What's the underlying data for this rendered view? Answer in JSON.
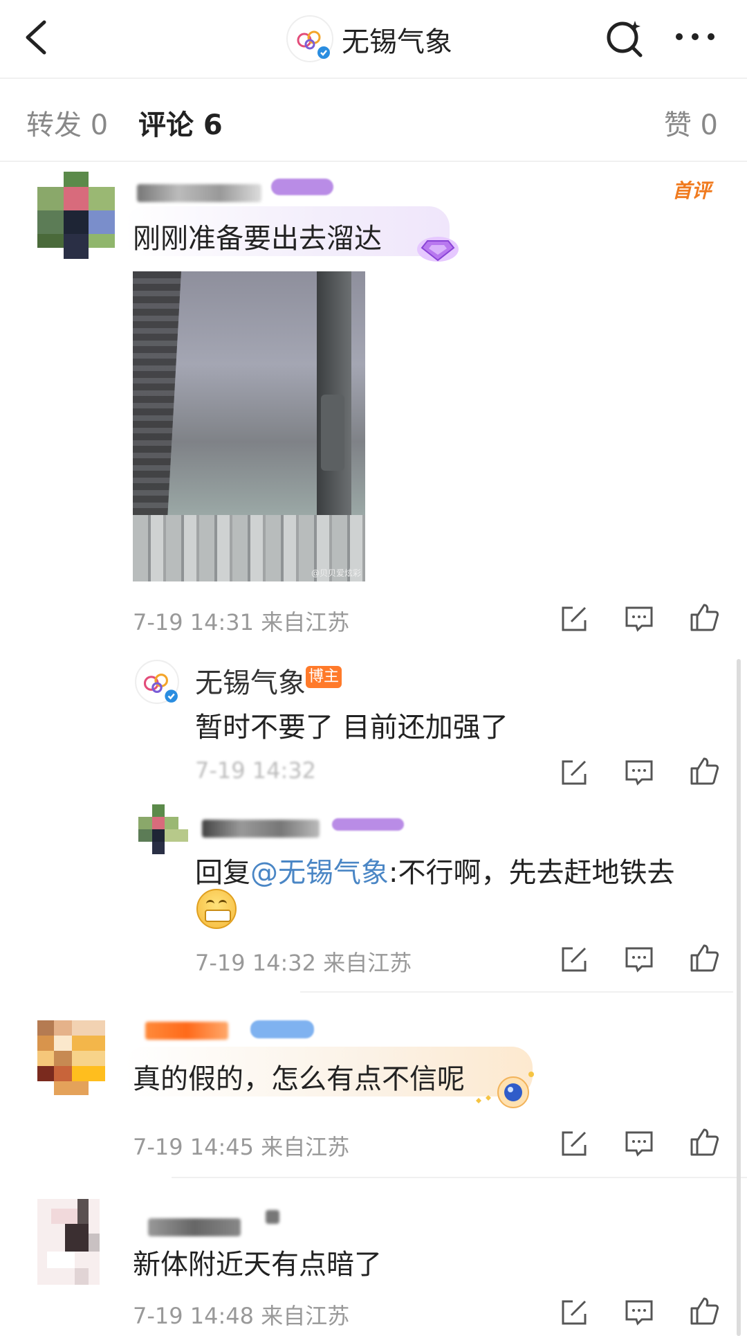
{
  "header": {
    "title": "无锡气象",
    "back_icon": "chevron-left-icon",
    "search_icon": "search-sparkle-icon",
    "more_icon": "more-horizontal-icon"
  },
  "tabs": {
    "repost": "转发 0",
    "comments": "评论 6",
    "likes": "赞 0"
  },
  "comments": [
    {
      "first_label": "首评",
      "text": "刚刚准备要出去溜达",
      "image_watermark": "@贝贝爱炫彩",
      "meta": "7-19 14:31  来自江苏",
      "replies": [
        {
          "author": "无锡气象",
          "badge": "博主",
          "text": "暂时不要了 目前还加强了",
          "meta": "7-19 14:32"
        },
        {
          "reply_prefix": "回复",
          "mention": "@无锡气象",
          "text": ":不行啊，先去赶地铁去",
          "meta": "7-19 14:32  来自江苏"
        }
      ]
    },
    {
      "text": "真的假的，怎么有点不信呢",
      "meta": "7-19 14:45  来自江苏"
    },
    {
      "text": "新体附近天有点暗了",
      "meta": "7-19 14:48  来自江苏"
    }
  ],
  "colors": {
    "accent_orange": "#f07a1e",
    "mention_blue": "#4a86c5",
    "meta_gray": "#999999"
  }
}
